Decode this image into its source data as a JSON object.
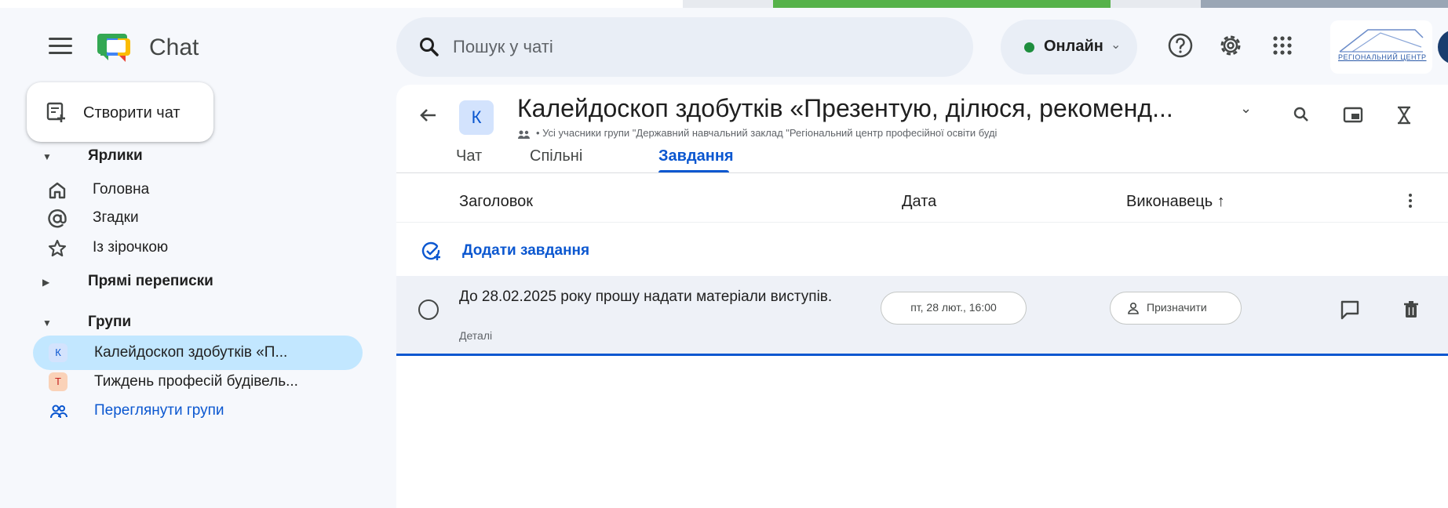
{
  "app": {
    "name": "Chat"
  },
  "search": {
    "placeholder": "Пошук у чаті"
  },
  "status": {
    "label": "Онлайн",
    "dot_color": "#1e8e3e"
  },
  "org_logo": {
    "text": "РЕГІОНАЛЬНИЙ ЦЕНТР"
  },
  "sidebar": {
    "create_label": "Створити чат",
    "shortcuts_header": "Ярлики",
    "shortcuts": [
      {
        "label": "Головна",
        "icon": "home-icon"
      },
      {
        "label": "Згадки",
        "icon": "at-sign-icon"
      },
      {
        "label": "Із зірочкою",
        "icon": "star-icon"
      }
    ],
    "dm_header": "Прямі переписки",
    "groups_header": "Групи",
    "groups": [
      {
        "label": "Калейдоскоп здобутків «П...",
        "avatar": "К",
        "active": true
      },
      {
        "label": "Тиждень професій будівель...",
        "avatar": "Т",
        "active": false
      }
    ],
    "browse_label": "Переглянути групи"
  },
  "room": {
    "avatar": "К",
    "title": "Калейдоскоп здобутків «Презентую, ділюся, рекоменд...",
    "subtitle": "Усі учасники групи \"Державний навчальний заклад \"Регіональний центр професійної освіти буді",
    "tabs": [
      {
        "label": "Чат",
        "active": false
      },
      {
        "label": "Спільні",
        "active": false
      },
      {
        "label": "Завдання",
        "active": true
      }
    ]
  },
  "tasks": {
    "columns": {
      "title": "Заголовок",
      "date": "Дата",
      "assignee": "Виконавець ↑"
    },
    "add_label": "Додати завдання",
    "items": [
      {
        "title": "До 28.02.2025 року прошу надати матеріали виступів.",
        "details": "Деталі",
        "date": "пт, 28 лют., 16:00",
        "assign_label": "Призначити"
      }
    ]
  },
  "colors": {
    "accent": "#0b57d0",
    "active_group_bg": "#c2e7ff",
    "page_bg": "#f6f8fc"
  }
}
